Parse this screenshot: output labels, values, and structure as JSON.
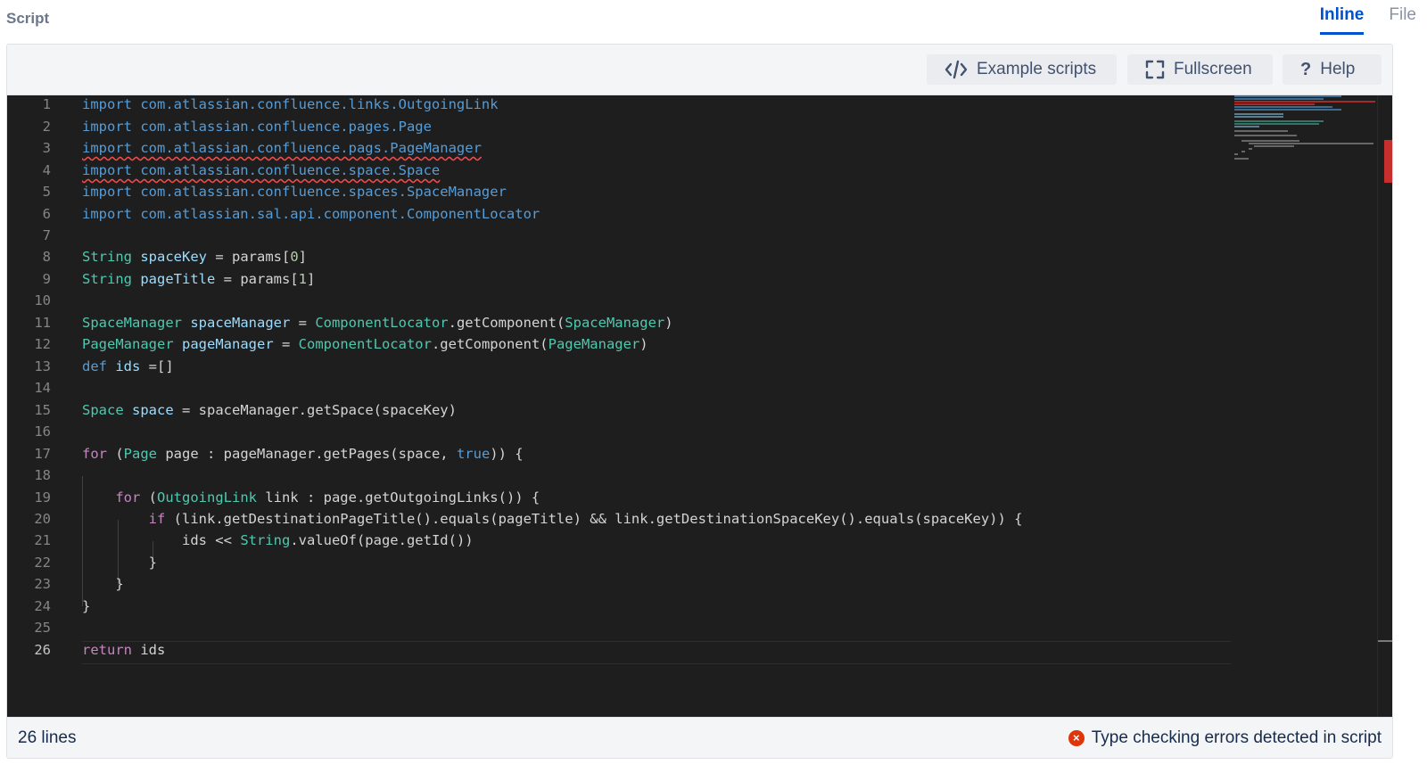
{
  "header": {
    "label": "Script",
    "tabs": [
      {
        "label": "Inline",
        "active": true
      },
      {
        "label": "File",
        "active": false
      }
    ]
  },
  "toolbar": {
    "example_label": "Example scripts",
    "fullscreen_label": "Fullscreen",
    "help_label": "Help"
  },
  "editor": {
    "current_line": 26,
    "line_numbers": [
      "1",
      "2",
      "3",
      "4",
      "5",
      "6",
      "7",
      "8",
      "9",
      "10",
      "11",
      "12",
      "13",
      "14",
      "15",
      "16",
      "17",
      "18",
      "19",
      "20",
      "21",
      "22",
      "23",
      "24",
      "25",
      "26"
    ]
  },
  "status": {
    "lines": "26 lines",
    "error": "Type checking errors detected in script"
  },
  "colors": {
    "accent": "#0052cc",
    "editor_bg": "#1e1e1e",
    "error": "#de350b"
  },
  "icons": [
    "code-icon",
    "fullscreen-icon",
    "help-icon",
    "error-icon"
  ]
}
